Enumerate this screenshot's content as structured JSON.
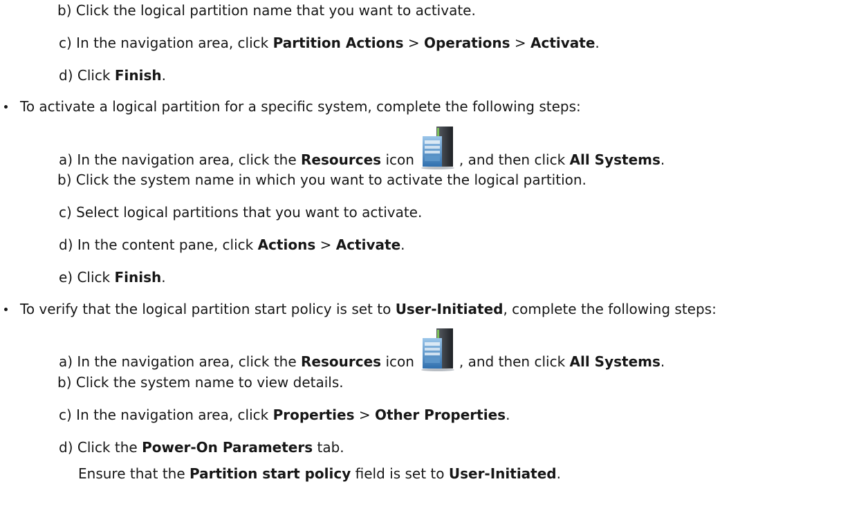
{
  "prior_steps": {
    "b_label": "b)",
    "b_text": "Click the logical partition name that you want to activate.",
    "c_label": "c)",
    "c_pre": "In the navigation area, click",
    "c_b1": "Partition Actions",
    "c_sep1": ">",
    "c_b2": "Operations",
    "c_sep2": ">",
    "c_b3": "Activate",
    "c_end": ".",
    "d_label": "d)",
    "d_pre": "Click",
    "d_b1": "Finish",
    "d_end": "."
  },
  "bullet1": {
    "text": "To activate a logical partition for a specific system, complete the following steps:",
    "a_label": "a)",
    "a_pre": "In the navigation area, click the",
    "a_b1": "Resources",
    "a_mid": "icon",
    "a_post": ", and then click",
    "a_b2": "All Systems",
    "a_end": ".",
    "b_label": "b)",
    "b_text": "Click the system name in which you want to activate the logical partition.",
    "c_label": "c)",
    "c_text": "Select logical partitions that you want to activate.",
    "d_label": "d)",
    "d_pre": "In the content pane, click",
    "d_b1": "Actions",
    "d_sep": ">",
    "d_b2": "Activate",
    "d_end": ".",
    "e_label": "e)",
    "e_pre": "Click",
    "e_b1": "Finish",
    "e_end": "."
  },
  "bullet2": {
    "pre": "To verify that the logical partition start policy is set to",
    "b1": "User-Initiated",
    "post": ", complete the following steps:",
    "a_label": "a)",
    "a_pre": "In the navigation area, click the",
    "a_b1": "Resources",
    "a_mid": "icon",
    "a_post": ", and then click",
    "a_b2": "All Systems",
    "a_end": ".",
    "b_label": "b)",
    "b_text": "Click the system name to view details.",
    "c_label": "c)",
    "c_pre": "In the navigation area, click",
    "c_b1": "Properties",
    "c_sep": ">",
    "c_b2": "Other Properties",
    "c_end": ".",
    "d_label": "d)",
    "d_pre": "Click the",
    "d_b1": "Power-On Parameters",
    "d_post": "tab.",
    "note_pre": "Ensure that the",
    "note_b1": "Partition start policy",
    "note_mid": "field is set to",
    "note_b2": "User-Initiated",
    "note_end": "."
  },
  "icons": [
    "resources-icon",
    "bullet-icon"
  ],
  "colors": {
    "text": "#161616",
    "icon_dark": "#2b2e33",
    "icon_blue": "#3a87c8",
    "icon_green": "#7cc04a"
  }
}
